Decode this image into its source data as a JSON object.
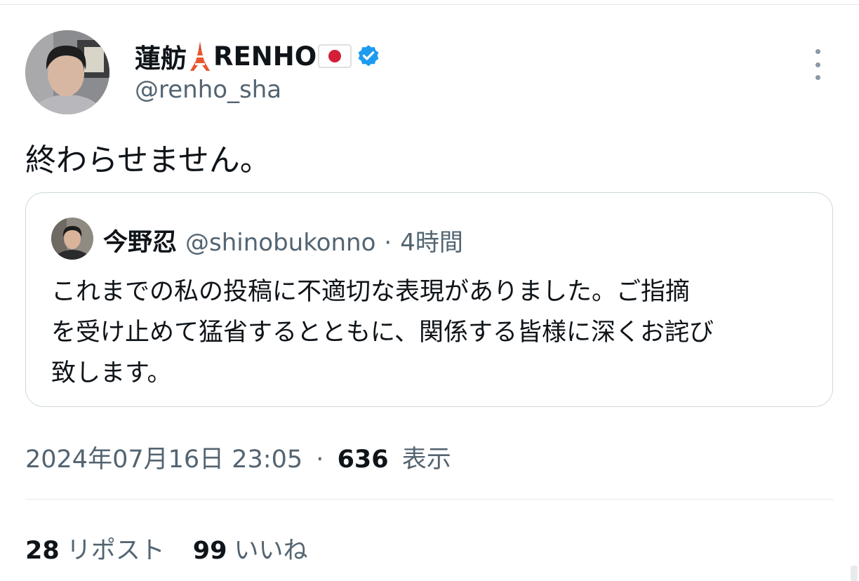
{
  "author": {
    "name_part1": "蓮舫",
    "name_part2": "RENHO",
    "handle": "@renho_sha",
    "badge_color": "#1d9bf0"
  },
  "tweet": {
    "text": "終わらせません。"
  },
  "quote": {
    "name": "今野忍",
    "handle": "@shinobukonno",
    "separator": "·",
    "time": "4時間",
    "lines": [
      "これまでの私の投稿に不適切な表現がありました。ご指摘",
      "を受け止めて猛省するとともに、関係する皆様に深くお詫び",
      "致します。"
    ]
  },
  "meta": {
    "datetime": "2024年07月16日 23:05",
    "separator": "·",
    "views_count": "636",
    "views_label": "表示"
  },
  "stats": {
    "reposts_count": "28",
    "reposts_label": "リポスト",
    "likes_count": "99",
    "likes_label": "いいね"
  },
  "icons": {
    "tower": "tokyo-tower-icon",
    "flag": "japan-flag-icon",
    "verified": "verified-badge-icon",
    "more": "more-options-icon"
  }
}
